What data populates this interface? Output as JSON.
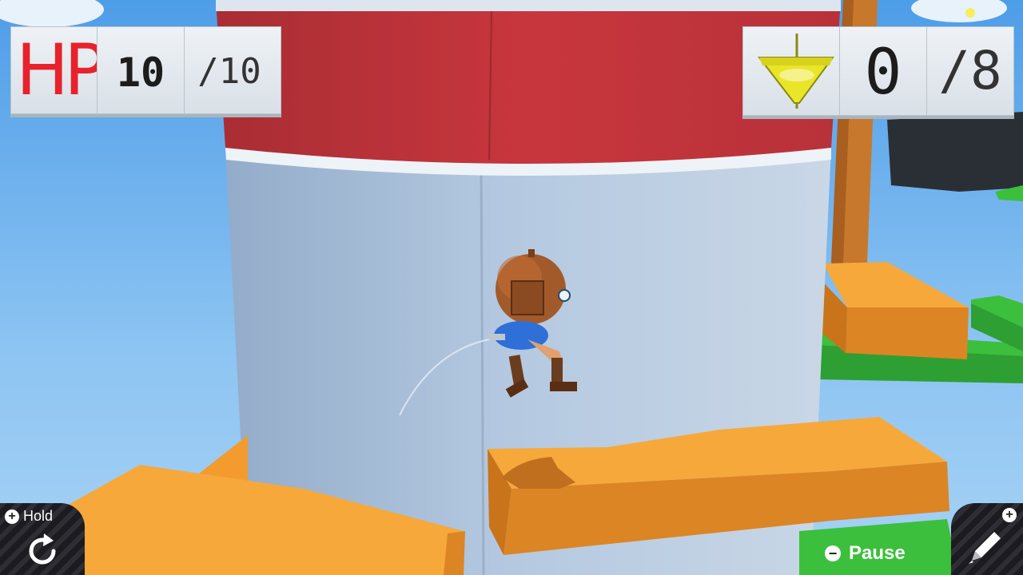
{
  "hud": {
    "hp_label": "HP",
    "hp_current": "10",
    "hp_max": "/10",
    "collectible_icon": "spinning-top-icon",
    "collectible_count": "0",
    "collectible_total": "/8"
  },
  "controls": {
    "hold_label": "Hold",
    "hold_icon": "rotate-icon",
    "pause_label": "Pause",
    "edit_icon": "pencil-icon"
  },
  "colors": {
    "hp_red": "#e8222b",
    "sky": "#6fb3ef",
    "tower": "#a9bfd8",
    "tower_cap": "#c8363d",
    "platform_orange": "#f39b2e",
    "grass_green": "#3cbf3c",
    "top_yellow": "#e9e62a"
  }
}
